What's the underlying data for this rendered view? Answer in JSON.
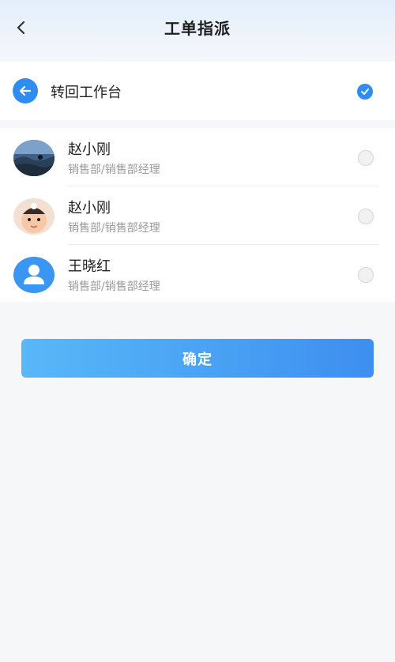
{
  "header": {
    "title": "工单指派",
    "back_icon": "chevron-left-icon"
  },
  "transfer": {
    "label": "转回工作台",
    "icon": "arrow-left-icon",
    "selected": true
  },
  "assignees": [
    {
      "name": "赵小刚",
      "department": "销售部/销售部经理",
      "avatar": "landscape-photo",
      "selected": false
    },
    {
      "name": "赵小刚",
      "department": "销售部/销售部经理",
      "avatar": "child-photo",
      "selected": false
    },
    {
      "name": "王晓红",
      "department": "销售部/销售部经理",
      "avatar": "default-user-icon",
      "selected": false
    }
  ],
  "actions": {
    "confirm_label": "确定"
  },
  "colors": {
    "accent": "#2f8cf0",
    "button_gradient_start": "#58b8f8",
    "button_gradient_end": "#3d8ff0",
    "secondary_text": "#9a9a9a"
  }
}
